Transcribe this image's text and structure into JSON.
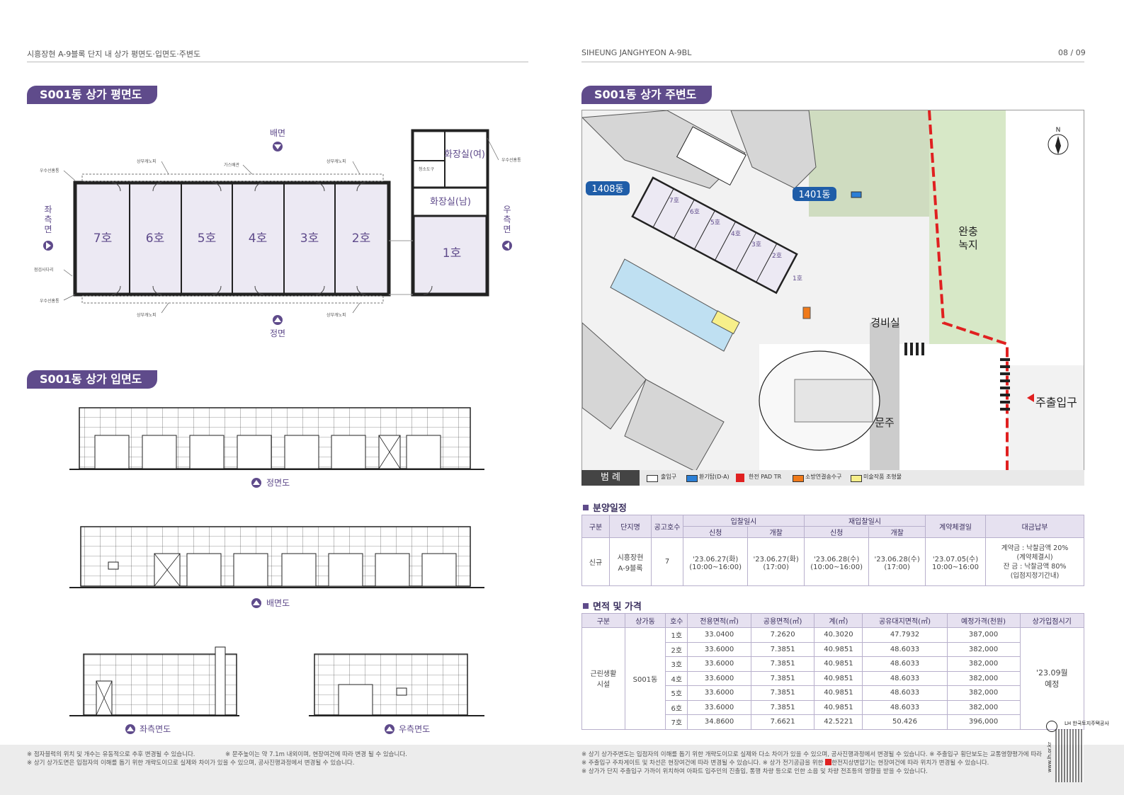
{
  "header": {
    "left_title": "시흥장현 A-9블록 단지 내 상가 평면도·입면도·주변도",
    "right_title": "SIHEUNG JANGHYEON A-9BL",
    "page_no": "08 / 09"
  },
  "floorplan": {
    "title": "S001동 상가 평면도",
    "back": "배면",
    "front": "정면",
    "left_side": "좌측면",
    "right_side": "우측면",
    "units": [
      "7호",
      "6호",
      "5호",
      "4호",
      "3호",
      "2호"
    ],
    "unit1": "1호",
    "wc_f": "화장실(여)",
    "wc_m": "화장실(남)",
    "notes": {
      "rain_pipe_1": "우수선홈통",
      "rain_pipe_2": "우수선홈통",
      "rain_pipe_3": "우수선홈통",
      "canopy_1": "상부캐노피",
      "canopy_2": "상부캐노피",
      "canopy_3": "상부캐노피",
      "canopy_4": "상부캐노피",
      "gas": "가스배관",
      "ladder": "점검사다리",
      "storage": "청소도구"
    }
  },
  "elevation": {
    "title": "S001동 상가 입면도",
    "front": "정면도",
    "back": "배면도",
    "left": "좌측면도",
    "right": "우측면도"
  },
  "sitemap": {
    "title": "S001동 상가 주변도",
    "bldg_1408": "1408동",
    "bldg_1401": "1401동",
    "green": "완충\n녹지",
    "guard": "경비실",
    "gate": "문주",
    "entrance": "주출입구",
    "north": "N",
    "shop_units": [
      "7호",
      "6호",
      "5호",
      "4호",
      "3호",
      "2호",
      "1호"
    ],
    "legend_label": "범 례",
    "legend": [
      "출입구",
      "환기탑(D-A)",
      "한전 PAD TR",
      "소방연결송수구",
      "미술작품 조형물"
    ],
    "legend_colors": [
      "#ffffff",
      "#2b7fd6",
      "#e02020",
      "#f07a1a",
      "#f7ef8a"
    ]
  },
  "schedule": {
    "title": "분양일정",
    "headers": {
      "type": "구분",
      "complex": "단지명",
      "count": "공고호수",
      "bid": "입찰일시",
      "rebid": "재입찰일시",
      "apply": "신청",
      "open": "개찰",
      "contract": "계약체결일",
      "payment": "대금납부"
    },
    "row": {
      "type": "신규",
      "complex": "시흥장현\nA-9블록",
      "count": "7",
      "bid_apply": "'23.06.27(화)",
      "bid_apply_time": "(10:00~16:00)",
      "bid_open": "'23.06.27(화)",
      "bid_open_time": "(17:00)",
      "rebid_apply": "'23.06.28(수)",
      "rebid_apply_time": "(10:00~16:00)",
      "rebid_open": "'23.06.28(수)",
      "rebid_open_time": "(17:00)",
      "contract": "'23.07.05(수)",
      "contract_time": "10:00~16:00",
      "payment_1": "계약금 : 낙찰금액 20%",
      "payment_2": "(계약체결시)",
      "payment_3": "잔 금 : 낙찰금액 80%",
      "payment_4": "(입점지정기간내)"
    }
  },
  "pricing": {
    "title": "면적 및 가격",
    "headers": [
      "구분",
      "상가동",
      "호수",
      "전용면적(㎡)",
      "공용면적(㎡)",
      "계(㎡)",
      "공유대지면적(㎡)",
      "예정가격(천원)",
      "상가입점시기"
    ],
    "category": "근린생활\n시설",
    "building": "S001동",
    "move_in": "'23.09월\n예정",
    "rows": [
      [
        "1호",
        "33.0400",
        "7.2620",
        "40.3020",
        "47.7932",
        "387,000"
      ],
      [
        "2호",
        "33.6000",
        "7.3851",
        "40.9851",
        "48.6033",
        "382,000"
      ],
      [
        "3호",
        "33.6000",
        "7.3851",
        "40.9851",
        "48.6033",
        "382,000"
      ],
      [
        "4호",
        "33.6000",
        "7.3851",
        "40.9851",
        "48.6033",
        "382,000"
      ],
      [
        "5호",
        "33.6000",
        "7.3851",
        "40.9851",
        "48.6033",
        "382,000"
      ],
      [
        "6호",
        "33.6000",
        "7.3851",
        "40.9851",
        "48.6033",
        "382,000"
      ],
      [
        "7호",
        "34.8600",
        "7.6621",
        "42.5221",
        "50.426",
        "396,000"
      ]
    ]
  },
  "footnotes": {
    "left_1": "※ 점자블럭의 위치 및 개수는 유동적으로 추후 변경될 수 있습니다.",
    "left_1b": "※ 문주높이는 약 7.1m 내외이며, 현장여건에 따라 변경 될 수 있습니다.",
    "left_2": "※ 상기 상가도면은 입점자의 이해를 돕기 위한 개략도이므로 실제와 차이가 있을 수 있으며, 공사진행과정에서 변경될 수 있습니다.",
    "right_1": "※ 상기 상가주변도는 입점자의 이해를 돕기 위한 개략도이므로 실제와 다소 차이가 있을 수 있으며, 공사진행과정에서 변경될 수 있습니다.  ※ 주출입구 횡단보도는 교통영향평가에 따라 변경될 수 있습니다.",
    "right_2": "※ 주출입구 주차게이트 및 차선은 현장여건에 따라 변경될 수 있습니다.  ※ 상가 전기공급을 위한",
    "right_2b": "한전지상변압기는 현장여건에 따라 위치가 변경될 수 있습니다.",
    "right_3": "※ 상가가 단지 주출입구 가까이 위치하여 아파트 입주민의 진출입, 통행 차량 등으로 인한 소음 및 차량 전조등의 영향을 받을 수 있습니다.",
    "lh_logo": "LH 한국토지주택공사",
    "lh_url": "www.lh.or.kr"
  }
}
